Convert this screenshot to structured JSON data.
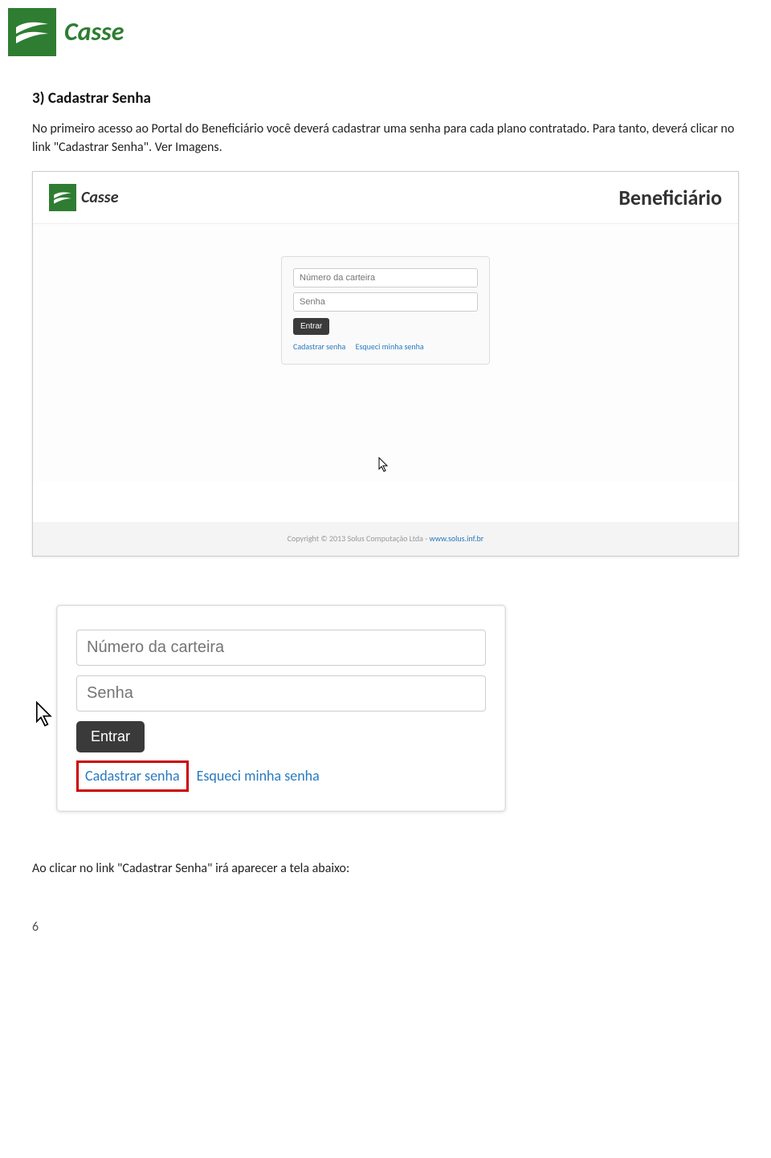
{
  "brand": {
    "name": "Casse"
  },
  "section": {
    "title": "3) Cadastrar Senha",
    "intro": "No primeiro acesso ao Portal do Beneficiário você deverá cadastrar uma senha para cada plano contratado. Para tanto, deverá clicar no link \"Cadastrar Senha\". Ver Imagens."
  },
  "screenshot1": {
    "role_label": "Beneficiário",
    "login": {
      "carteira_placeholder": "Número da carteira",
      "senha_placeholder": "Senha",
      "entrar_label": "Entrar",
      "cadastrar_link": "Cadastrar senha",
      "esqueci_link": "Esqueci minha senha"
    },
    "footer": {
      "copyright": "Copyright © 2013 Solus Computação Ltda - ",
      "url_text": "www.solus.inf.br"
    }
  },
  "screenshot2": {
    "login": {
      "carteira_placeholder": "Número da carteira",
      "senha_placeholder": "Senha",
      "entrar_label": "Entrar",
      "cadastrar_link": "Cadastrar senha",
      "esqueci_link": "Esqueci minha senha"
    }
  },
  "closing_text": "Ao clicar no link \"Cadastrar Senha\" irá aparecer a tela abaixo:",
  "page_number": "6"
}
